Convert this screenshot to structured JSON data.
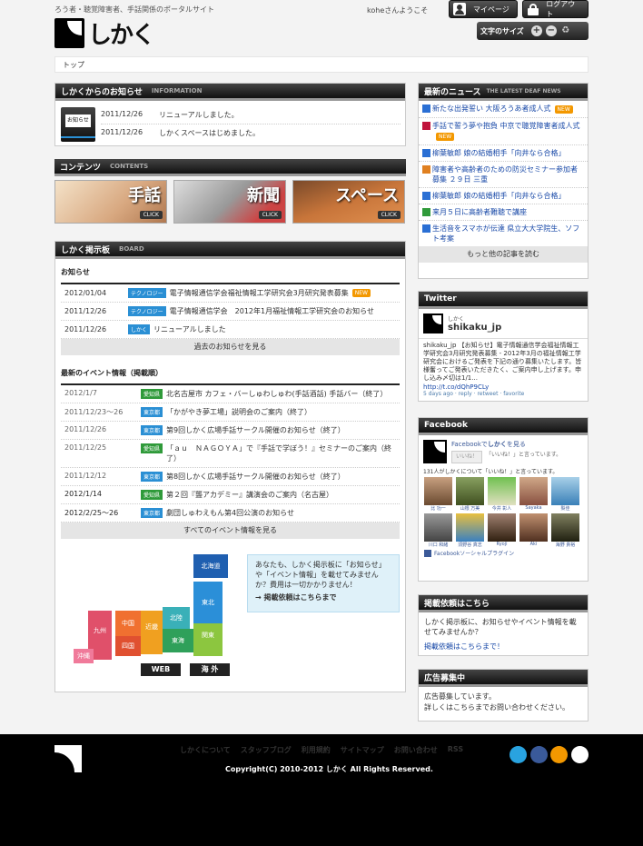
{
  "header": {
    "tagline": "ろう者・聴覚障害者、手話関係のポータルサイト",
    "logo_text": "しかく",
    "welcome": "koheさんようこそ",
    "mypage": "マイページ",
    "logout": "ログアウト",
    "font_size_label": "文字のサイズ",
    "font_plus": "+",
    "font_minus": "−",
    "font_reset": "♻"
  },
  "breadcrumb": "トップ",
  "news_box": {
    "title": "しかくからのお知らせ",
    "sub": "INFORMATION",
    "badge": "お知らせ",
    "items": [
      {
        "date": "2011/12/26",
        "text": "リニューアルしました。"
      },
      {
        "date": "2011/12/26",
        "text": "しかくスペースはじめました。"
      }
    ]
  },
  "contents": {
    "title": "コンテンツ",
    "sub": "CONTENTS",
    "click": "CLICK",
    "banners": [
      "手話",
      "新聞",
      "スペース"
    ]
  },
  "board": {
    "title": "しかく掲示板",
    "sub": "BOARD",
    "notice_title": "お知らせ",
    "notices": [
      {
        "date": "2012/01/04",
        "tag": "テクノロジー",
        "text": "電子情報通信学会福祉情報工学研究会3月研究発表募集",
        "new": "NEW"
      },
      {
        "date": "2011/12/26",
        "tag": "テクノロジー",
        "text": "電子情報通信学会　2012年1月福祉情報工学研究会のお知らせ"
      },
      {
        "date": "2011/12/26",
        "tag": "しかく",
        "text": "リニューアルしました"
      }
    ],
    "notice_more": "過去のお知らせを見る",
    "event_title": "最新のイベント情報（掲載順）",
    "events": [
      {
        "date": "2012/1/7",
        "tag": "愛知県",
        "text": "北名古屋市 カフェ・バーしゅわしゅわ(手話酒話) 手話バー（終了）"
      },
      {
        "date": "2011/12/23〜26",
        "tag": "東京都",
        "text": "「かがやき夢工場」説明会のご案内（終了）"
      },
      {
        "date": "2011/12/26",
        "tag": "東京都",
        "text": "第9回しかく広場手話サークル開催のお知らせ（終了）"
      },
      {
        "date": "2011/12/25",
        "tag": "愛知県",
        "text": "「ａｕ　ＮＡＧＯＹＡ」で『手話で学ぼう！』セミナーのご案内（終了）"
      },
      {
        "date": "2011/12/12",
        "tag": "東京都",
        "text": "第8回しかく広場手話サークル開催のお知らせ（終了）"
      },
      {
        "date": "2012/1/14",
        "tag": "愛知県",
        "text": "第２回『聾アカデミー』講演会のご案内（名古屋）"
      },
      {
        "date": "2012/2/25〜26",
        "tag": "東京都",
        "text": "劇団しゅわえもん第4回公演のお知らせ"
      }
    ],
    "event_more": "すべてのイベント情報を見る",
    "map": {
      "regions": [
        "北海道",
        "東北",
        "関東",
        "北陸",
        "東海",
        "近畿",
        "中国",
        "四国",
        "九州",
        "沖縄"
      ],
      "web": "WEB",
      "overseas": "海 外"
    },
    "promo_text": "あなたも、しかく掲示板に「お知らせ」や「イベント情報」を載せてみませんか？費用は一切かかりません！",
    "promo_link": "→ 掲載依頼はこちらまで"
  },
  "latest_news": {
    "title": "最新のニュース",
    "sub": "THE LATEST DEAF NEWS",
    "items": [
      {
        "text": "新たな出発誓い 大阪ろうあ者成人式",
        "new": "NEW",
        "color": "#2a6fd4"
      },
      {
        "text": "手話で誓う夢や抱負 中京で聴覚障害者成人式",
        "new": "NEW",
        "color": "#c0143c"
      },
      {
        "text": "柳葉敏郎 娘の結婚相手「向井なら合格」",
        "color": "#2a6fd4"
      },
      {
        "text": "障害者や高齢者のための防災セミナー参加者募集 ２９日 三重",
        "color": "#e08020"
      },
      {
        "text": "柳葉敏郎 娘の結婚相手「向井なら合格」",
        "color": "#2a6fd4"
      },
      {
        "text": "来月５日に高齢者難聴で講座",
        "color": "#2f9a3a"
      },
      {
        "text": "生活音をスマホが伝達 県立大大学院生、ソフト考案",
        "color": "#2a6fd4"
      }
    ],
    "more": "もっと他の記事を読む"
  },
  "twitter": {
    "title": "Twitter",
    "name_small": "しかく",
    "handle": "shikaku_jp",
    "tweet": "shikaku_jp 【お知らせ】電子情報通信学会福祉情報工学研究会3月研究発表募集 - 2012年3月の福祉情報工学研究会におけるご発表を下記の通り募集いたします。皆様奮ってご発表いただきたく、ご案内申し上げます。申し込み〆切は1/1...",
    "link": "http://t.co/dQhP9CLy",
    "meta": "5 days ago · reply · retweet · favorite"
  },
  "facebook": {
    "title": "Facebook",
    "prefix": "Facebookで",
    "name": "しかく",
    "suffix": "を見る",
    "like": "いいね！",
    "like_note": "「いいね！」と言っています。",
    "count_text": "131人がしかくについて「いいね！」と言っています。",
    "faces_row1": [
      "比 功一",
      "山根 万美",
      "今井 彰人",
      "Sayaka",
      "梨佳"
    ],
    "faces_row2": [
      "川口 和緒",
      "須野谷 真志",
      "Ryoji",
      "Aki",
      "海野 貴裕"
    ],
    "plugin": "Facebookソーシャルプラグイン"
  },
  "post_request": {
    "title": "掲載依頼はこちら",
    "text": "しかく掲示板に、お知らせやイベント情報を載せてみませんか？",
    "link": "掲載依頼はこちらまで！"
  },
  "ads": {
    "title": "広告募集中",
    "line1": "広告募集しています。",
    "line2": "詳しくはこちらまでお問い合わせください。"
  },
  "footer": {
    "links": [
      "しかくについて",
      "スタッフブログ",
      "利用規約",
      "サイトマップ",
      "お問い合わせ",
      "RSS"
    ],
    "copyright": "Copyright(C) 2010-2012 しかく All Rights Reserved.",
    "circle_colors": [
      "#29a3e0",
      "#3a5a9a",
      "#f39800",
      "#ffffff"
    ]
  }
}
